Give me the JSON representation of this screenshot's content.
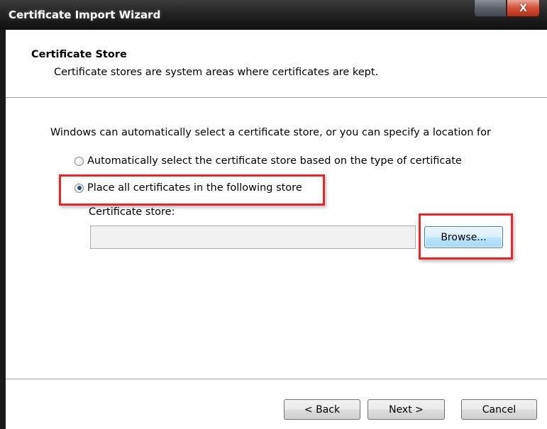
{
  "window": {
    "title": "Certificate Import Wizard",
    "close_glyph": "X"
  },
  "header": {
    "title": "Certificate Store",
    "description": "Certificate stores are system areas where certificates are kept."
  },
  "body": {
    "intro": "Windows can automatically select a certificate store, or you can specify a location for",
    "options": [
      {
        "label": "Automatically select the certificate store based on the type of certificate",
        "selected": false
      },
      {
        "label": "Place all certificates in the following store",
        "selected": true
      }
    ],
    "store_label": "Certificate store:",
    "store_value": "",
    "browse_label": "Browse..."
  },
  "footer": {
    "back_label": "< Back",
    "next_label": "Next >",
    "cancel_label": "Cancel"
  },
  "colors": {
    "highlight": "#e8252b",
    "radio_selected": "#1f4d8f",
    "titlebar": "#1a1a1a",
    "close_button": "#c63a22"
  },
  "icons": [
    "minimize-button-icon",
    "close-x-icon",
    "radio-button-icon"
  ]
}
